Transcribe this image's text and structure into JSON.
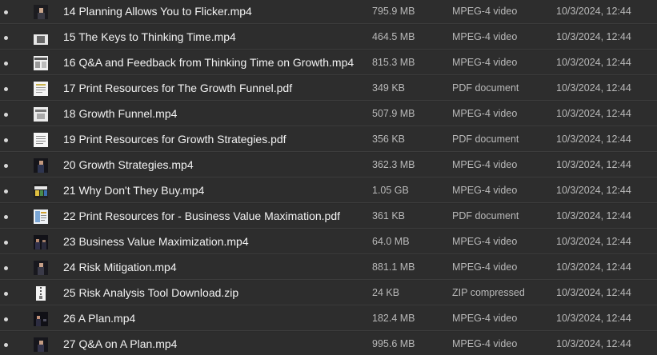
{
  "files": [
    {
      "name": "14 Planning Allows You to Flicker.mp4",
      "size": "795.9 MB",
      "type": "MPEG-4 video",
      "modified": "10/3/2024, 12:44",
      "thumb": "video-thumbnail-icon"
    },
    {
      "name": "15 The Keys to Thinking Time.mp4",
      "size": "464.5 MB",
      "type": "MPEG-4 video",
      "modified": "10/3/2024, 12:44",
      "thumb": "video-thumbnail-icon"
    },
    {
      "name": "16 Q&A and Feedback from Thinking Time on Growth.mp4",
      "size": "815.3 MB",
      "type": "MPEG-4 video",
      "modified": "10/3/2024, 12:44",
      "thumb": "video-thumbnail-icon"
    },
    {
      "name": "17 Print Resources for The Growth Funnel.pdf",
      "size": "349 KB",
      "type": "PDF document",
      "modified": "10/3/2024, 12:44",
      "thumb": "pdf-thumbnail-icon"
    },
    {
      "name": "18 Growth Funnel.mp4",
      "size": "507.9 MB",
      "type": "MPEG-4 video",
      "modified": "10/3/2024, 12:44",
      "thumb": "video-thumbnail-icon"
    },
    {
      "name": "19 Print Resources for Growth Strategies.pdf",
      "size": "356 KB",
      "type": "PDF document",
      "modified": "10/3/2024, 12:44",
      "thumb": "pdf-thumbnail-icon"
    },
    {
      "name": "20 Growth Strategies.mp4",
      "size": "362.3 MB",
      "type": "MPEG-4 video",
      "modified": "10/3/2024, 12:44",
      "thumb": "video-thumbnail-icon"
    },
    {
      "name": "21 Why Don't They Buy.mp4",
      "size": "1.05 GB",
      "type": "MPEG-4 video",
      "modified": "10/3/2024, 12:44",
      "thumb": "video-thumbnail-icon"
    },
    {
      "name": "22 Print Resources for - Business Value Maximation.pdf",
      "size": "361 KB",
      "type": "PDF document",
      "modified": "10/3/2024, 12:44",
      "thumb": "pdf-thumbnail-icon"
    },
    {
      "name": "23 Business Value Maximization.mp4",
      "size": "64.0 MB",
      "type": "MPEG-4 video",
      "modified": "10/3/2024, 12:44",
      "thumb": "video-thumbnail-icon"
    },
    {
      "name": "24 Risk Mitigation.mp4",
      "size": "881.1 MB",
      "type": "MPEG-4 video",
      "modified": "10/3/2024, 12:44",
      "thumb": "video-thumbnail-icon"
    },
    {
      "name": "25 Risk Analysis Tool Download.zip",
      "size": "24 KB",
      "type": "ZIP compressed",
      "modified": "10/3/2024, 12:44",
      "thumb": "zip-archive-icon"
    },
    {
      "name": "26 A Plan.mp4",
      "size": "182.4 MB",
      "type": "MPEG-4 video",
      "modified": "10/3/2024, 12:44",
      "thumb": "video-thumbnail-icon"
    },
    {
      "name": "27 Q&A on A Plan.mp4",
      "size": "995.6 MB",
      "type": "MPEG-4 video",
      "modified": "10/3/2024, 12:44",
      "thumb": "video-thumbnail-icon"
    }
  ],
  "colors": {
    "background": "#2d2d2d",
    "row_divider": "#3c3c3c",
    "name_text": "#f2f2f2",
    "meta_text": "#b9b9b9",
    "bullet": "#d8d8d8"
  }
}
